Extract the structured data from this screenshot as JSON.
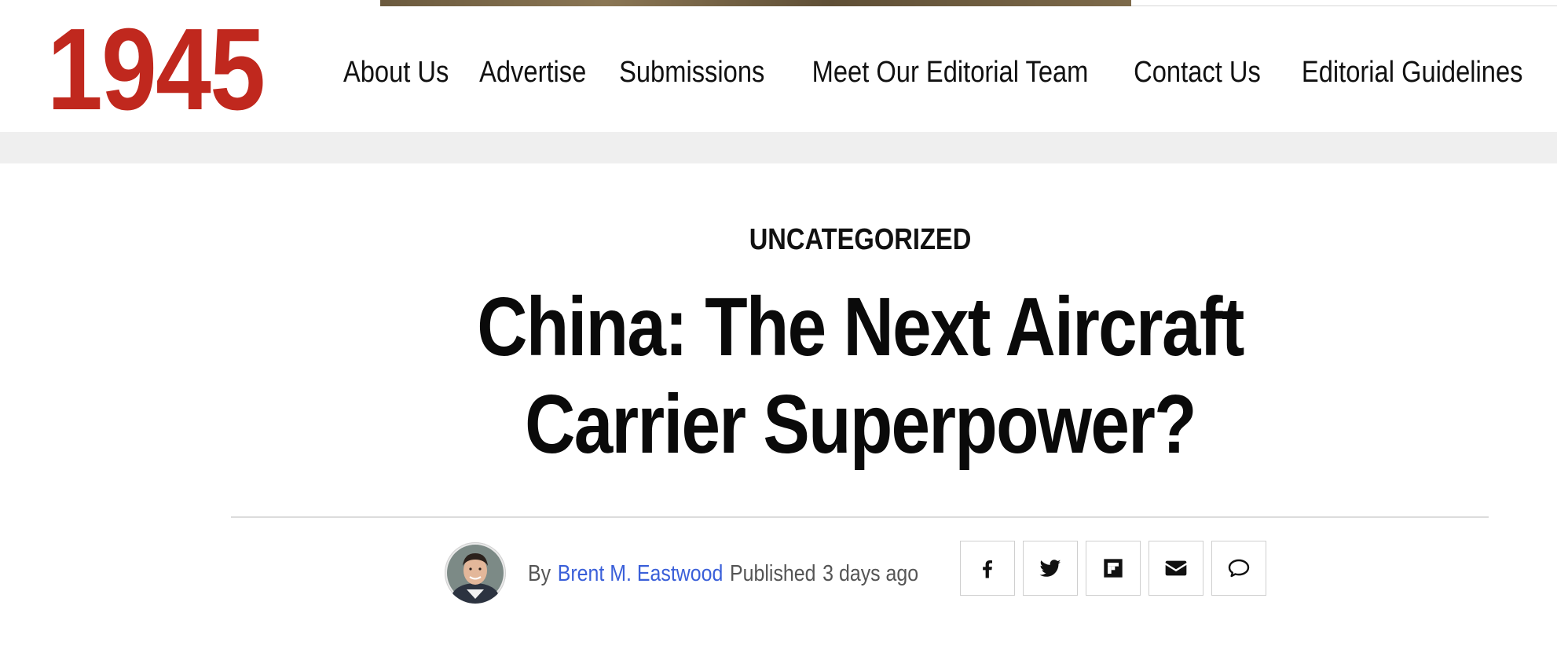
{
  "site": {
    "logo_text": "1945",
    "brand_color": "#c0281e"
  },
  "nav": {
    "items": [
      {
        "label": "About Us"
      },
      {
        "label": "Advertise"
      },
      {
        "label": "Submissions"
      },
      {
        "label": "Meet Our Editorial Team"
      },
      {
        "label": "Contact Us"
      },
      {
        "label": "Editorial Guidelines"
      }
    ]
  },
  "article": {
    "category": "UNCATEGORIZED",
    "title": "China: The Next Aircraft Carrier Superpower?",
    "byline": {
      "by_label": "By",
      "author": "Brent M. Eastwood",
      "author_color": "#3a5fd9",
      "published_label": "Published",
      "published_time": "3 days ago"
    }
  },
  "share": {
    "buttons": [
      {
        "icon": "facebook-icon"
      },
      {
        "icon": "twitter-icon"
      },
      {
        "icon": "flipboard-icon"
      },
      {
        "icon": "email-icon"
      },
      {
        "icon": "comment-icon"
      }
    ]
  }
}
